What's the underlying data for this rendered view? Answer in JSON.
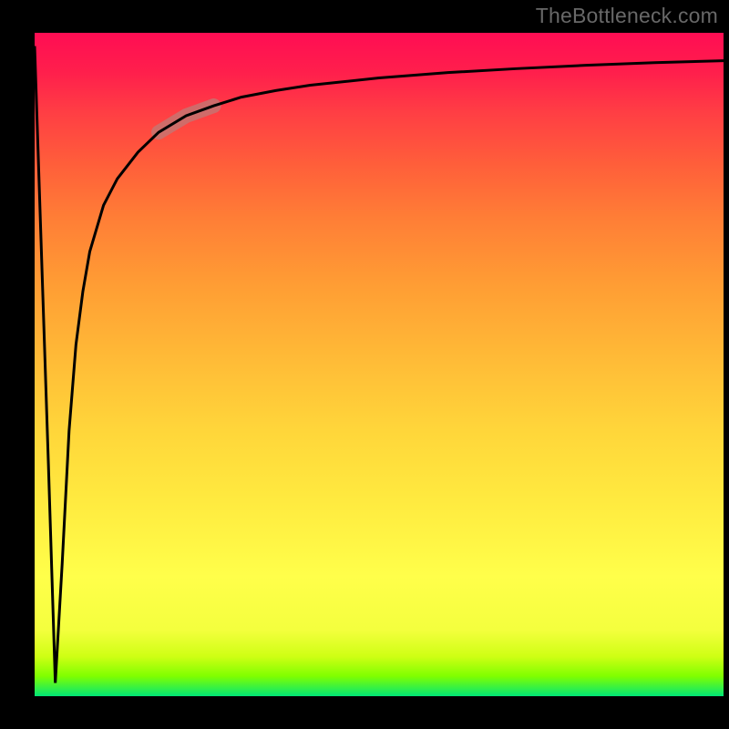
{
  "watermark": "TheBottleneck.com",
  "chart_data": {
    "type": "line",
    "title": "",
    "xlabel": "",
    "ylabel": "",
    "xlim": [
      0,
      100
    ],
    "ylim": [
      0,
      100
    ],
    "x": [
      0,
      2,
      3,
      4,
      5,
      6,
      7,
      8,
      10,
      12,
      15,
      18,
      22,
      26,
      30,
      35,
      40,
      50,
      60,
      70,
      80,
      90,
      100
    ],
    "values": [
      98,
      35,
      2,
      20,
      40,
      53,
      61,
      67,
      74,
      78,
      82,
      85,
      87.5,
      89,
      90.3,
      91.3,
      92.1,
      93.2,
      94.0,
      94.6,
      95.1,
      95.5,
      95.8
    ],
    "highlight_segment": {
      "x0": 18,
      "x1": 26
    },
    "gradient_stops": [
      {
        "pos": 0.0,
        "color": "#00e676"
      },
      {
        "pos": 0.03,
        "color": "#7fff00"
      },
      {
        "pos": 0.1,
        "color": "#f4ff3e"
      },
      {
        "pos": 0.3,
        "color": "#ffe93f"
      },
      {
        "pos": 0.5,
        "color": "#ffbd37"
      },
      {
        "pos": 0.72,
        "color": "#ff7e36"
      },
      {
        "pos": 0.88,
        "color": "#ff3e44"
      },
      {
        "pos": 1.0,
        "color": "#ff0d53"
      }
    ]
  }
}
